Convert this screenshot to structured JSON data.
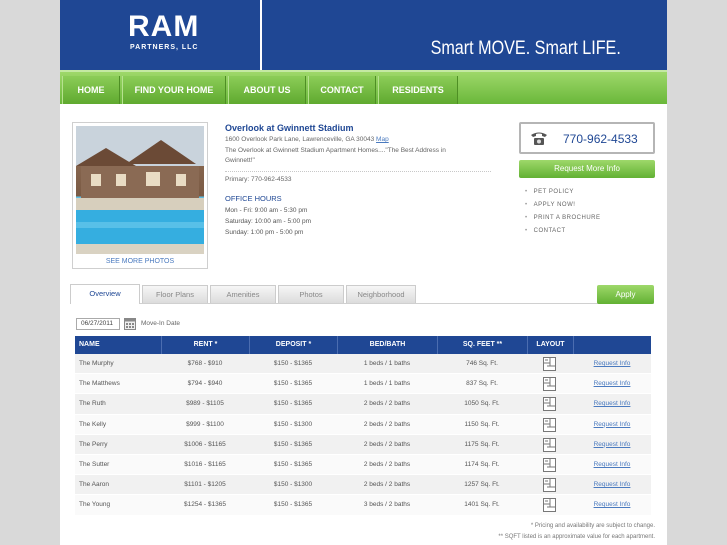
{
  "header": {
    "logo_main": "RAM",
    "logo_sub": "PARTNERS, LLC",
    "tagline": "Smart MOVE. Smart LIFE."
  },
  "nav": {
    "items": [
      {
        "label": "HOME"
      },
      {
        "label": "FIND YOUR HOME"
      },
      {
        "label": "ABOUT US"
      },
      {
        "label": "CONTACT"
      },
      {
        "label": "RESIDENTS"
      }
    ]
  },
  "property": {
    "see_more": "SEE MORE PHOTOS",
    "name": "Overlook at Gwinnett Stadium",
    "address": "1600 Overlook Park Lane, Lawrenceville, GA 30043",
    "map_label": "Map",
    "description": "The Overlook at Gwinnett Stadium Apartment Homes....\"The Best Address in Gwinnett!\"",
    "primary_phone": "Primary: 770-962-4533",
    "office_hours_title": "OFFICE HOURS",
    "hours": [
      "Mon - Fri:  9:00 am - 5:30 pm",
      "Saturday:   10:00 am - 5:00 pm",
      "Sunday:   1:00 pm - 5:00 pm"
    ]
  },
  "contact": {
    "phone": "770-962-4533",
    "request_button": "Request More Info",
    "links": [
      "PET POLICY",
      "APPLY NOW!",
      "PRINT A BROCHURE",
      "CONTACT"
    ]
  },
  "tabs": [
    {
      "label": "Overview",
      "active": true
    },
    {
      "label": "Floor Plans",
      "active": false
    },
    {
      "label": "Amenities",
      "active": false
    },
    {
      "label": "Photos",
      "active": false
    },
    {
      "label": "Neighborhood",
      "active": false
    }
  ],
  "apply_button": "Apply",
  "filter": {
    "date_value": "06/27/2011",
    "date_label": "Move-In Date"
  },
  "table": {
    "headers": [
      "NAME",
      "RENT *",
      "DEPOSIT *",
      "BED/BATH",
      "SQ. FEET **",
      "LAYOUT",
      ""
    ],
    "rows": [
      {
        "name": "The Murphy",
        "rent": "$768  -  $910",
        "deposit": "$150  -  $1365",
        "bedbath": "1 beds / 1 baths",
        "sqft": "746 Sq. Ft.",
        "action": "Request Info"
      },
      {
        "name": "The Matthews",
        "rent": "$794  -  $940",
        "deposit": "$150  -  $1365",
        "bedbath": "1 beds / 1 baths",
        "sqft": "837 Sq. Ft.",
        "action": "Request Info"
      },
      {
        "name": "The Ruth",
        "rent": "$989  -  $1105",
        "deposit": "$150  -  $1365",
        "bedbath": "2 beds / 2 baths",
        "sqft": "1050 Sq. Ft.",
        "action": "Request Info"
      },
      {
        "name": "The Kelly",
        "rent": "$999  -  $1100",
        "deposit": "$150  -  $1300",
        "bedbath": "2 beds / 2 baths",
        "sqft": "1150 Sq. Ft.",
        "action": "Request Info"
      },
      {
        "name": "The Perry",
        "rent": "$1006  -  $1165",
        "deposit": "$150  -  $1365",
        "bedbath": "2 beds / 2 baths",
        "sqft": "1175 Sq. Ft.",
        "action": "Request Info"
      },
      {
        "name": "The Sutter",
        "rent": "$1016  -  $1165",
        "deposit": "$150  -  $1365",
        "bedbath": "2 beds / 2 baths",
        "sqft": "1174 Sq. Ft.",
        "action": "Request Info"
      },
      {
        "name": "The Aaron",
        "rent": "$1101  -  $1205",
        "deposit": "$150  -  $1300",
        "bedbath": "2 beds / 2 baths",
        "sqft": "1257 Sq. Ft.",
        "action": "Request Info"
      },
      {
        "name": "The Young",
        "rent": "$1254  -  $1365",
        "deposit": "$150  -  $1365",
        "bedbath": "3 beds / 2 baths",
        "sqft": "1401 Sq. Ft.",
        "action": "Request Info"
      }
    ]
  },
  "footnotes": [
    "* Pricing and availability are subject to change.",
    "** SQFT listed is an approximate value for each apartment."
  ],
  "colors": {
    "brand_blue": "#1f4794",
    "accent_green": "#6ab83a",
    "link_blue": "#4a7abf"
  }
}
